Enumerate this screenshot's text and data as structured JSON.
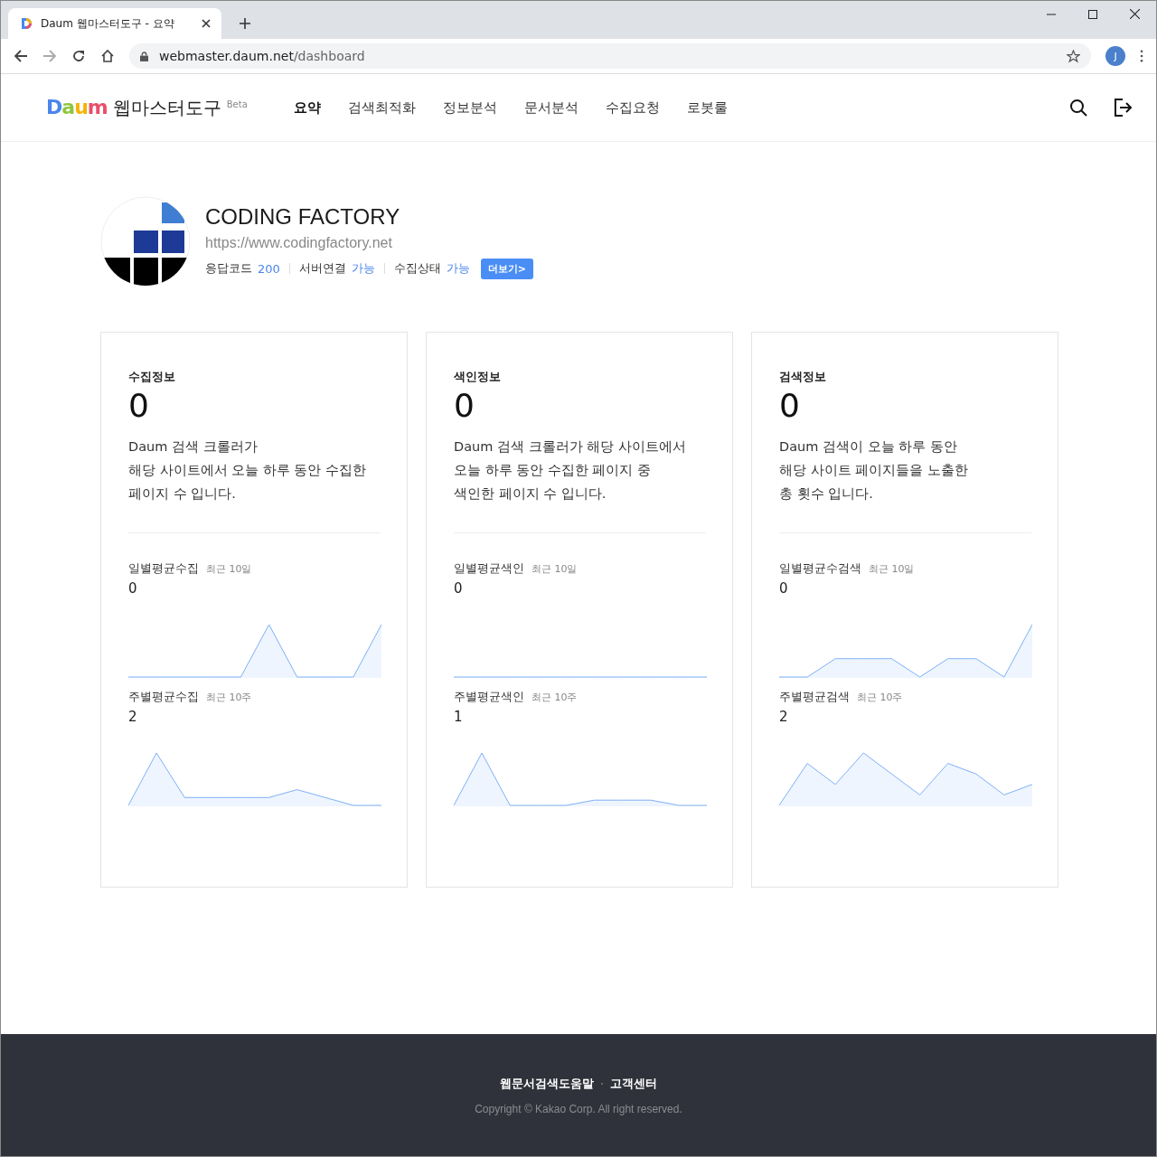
{
  "browser": {
    "tab_title": "Daum 웹마스터도구 - 요약",
    "url_host": "webmaster.daum.net",
    "url_path": "/dashboard",
    "profile_initial": "J"
  },
  "header": {
    "logo": "Daum",
    "tool_name": "웹마스터도구",
    "badge": "Beta",
    "nav": [
      {
        "label": "요약",
        "selected": true
      },
      {
        "label": "검색최적화",
        "selected": false
      },
      {
        "label": "정보분석",
        "selected": false
      },
      {
        "label": "문서분석",
        "selected": false
      },
      {
        "label": "수집요청",
        "selected": false
      },
      {
        "label": "로봇룰",
        "selected": false
      }
    ]
  },
  "site": {
    "name": "CODING FACTORY",
    "url": "https://www.codingfactory.net",
    "statuses": [
      {
        "label": "응답코드",
        "value": "200"
      },
      {
        "label": "서버연결",
        "value": "가능"
      },
      {
        "label": "수집상태",
        "value": "가능"
      }
    ],
    "more_button": "더보기>"
  },
  "cards": [
    {
      "title": "수집정보",
      "count": "0",
      "description": [
        "Daum 검색 크롤러가",
        "해당 사이트에서 오늘 하루 동안 수집한",
        "페이지 수 입니다."
      ],
      "stats": [
        {
          "label": "일별평균수집",
          "period": "최근 10일",
          "value": "0"
        },
        {
          "label": "주별평균수집",
          "period": "최근 10주",
          "value": "2"
        }
      ]
    },
    {
      "title": "색인정보",
      "count": "0",
      "description": [
        "Daum 검색 크롤러가 해당 사이트에서",
        "오늘 하루 동안 수집한 페이지 중",
        "색인한 페이지 수 입니다."
      ],
      "stats": [
        {
          "label": "일별평균색인",
          "period": "최근 10일",
          "value": "0"
        },
        {
          "label": "주별평균색인",
          "period": "최근 10주",
          "value": "1"
        }
      ]
    },
    {
      "title": "검색정보",
      "count": "0",
      "description": [
        "Daum 검색이 오늘 하루 동안",
        "해당 사이트 페이지들을 노출한",
        "총 횟수 입니다."
      ],
      "stats": [
        {
          "label": "일별평균수검색",
          "period": "최근 10일",
          "value": "0"
        },
        {
          "label": "주별평균검색",
          "period": "최근 10주",
          "value": "2"
        }
      ]
    }
  ],
  "footer": {
    "links": [
      "웹문서검색도움말",
      "고객센터"
    ],
    "copyright": "Copyright © Kakao Corp. All right reserved."
  }
}
